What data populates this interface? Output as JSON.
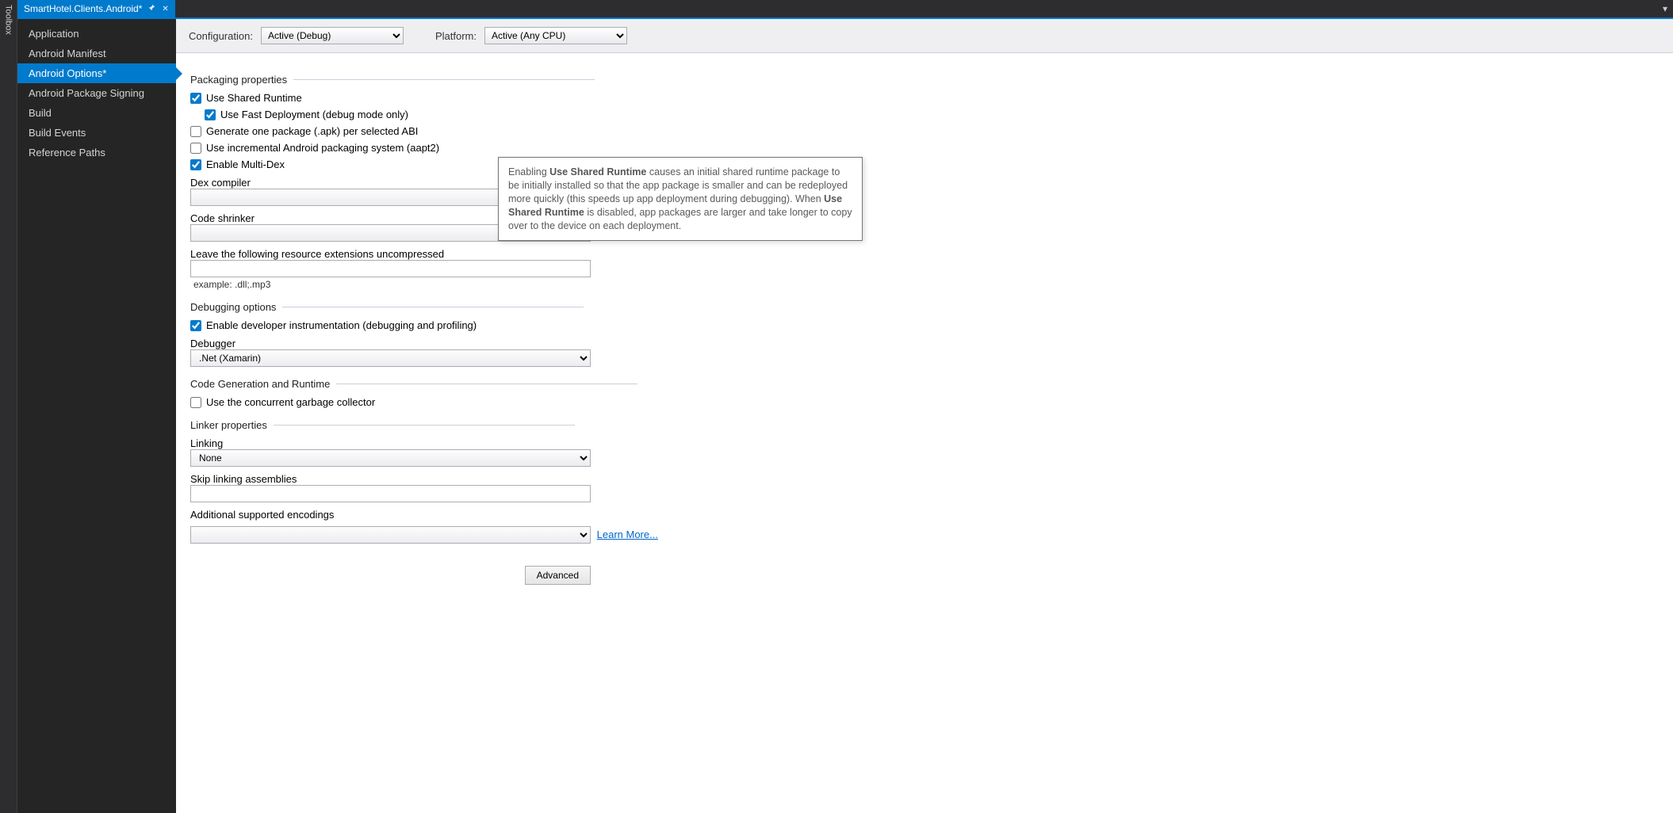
{
  "toolbox": {
    "label": "Toolbox"
  },
  "tab": {
    "title": "SmartHotel.Clients.Android*"
  },
  "overflow_glyph": "▾",
  "nav": {
    "items": [
      {
        "label": "Application",
        "selected": false
      },
      {
        "label": "Android Manifest",
        "selected": false
      },
      {
        "label": "Android Options*",
        "selected": true
      },
      {
        "label": "Android Package Signing",
        "selected": false
      },
      {
        "label": "Build",
        "selected": false
      },
      {
        "label": "Build Events",
        "selected": false
      },
      {
        "label": "Reference Paths",
        "selected": false
      }
    ]
  },
  "configbar": {
    "config_label": "Configuration:",
    "config_value": "Active (Debug)",
    "platform_label": "Platform:",
    "platform_value": "Active (Any CPU)"
  },
  "sections": {
    "packaging": "Packaging properties",
    "debugging": "Debugging options",
    "codegen": "Code Generation and Runtime",
    "linker": "Linker properties"
  },
  "fields": {
    "use_shared_runtime": "Use Shared Runtime",
    "use_fast_deployment": "Use Fast Deployment (debug mode only)",
    "gen_one_pkg": "Generate one package (.apk) per selected ABI",
    "incremental_pkg": "Use incremental Android packaging system (aapt2)",
    "multi_dex": "Enable Multi-Dex",
    "dex_compiler": "Dex compiler",
    "code_shrinker": "Code shrinker",
    "uncompressed": "Leave the following resource extensions uncompressed",
    "uncompressed_hint": "example: .dll;.mp3",
    "dev_instrumentation": "Enable developer instrumentation (debugging and profiling)",
    "debugger": "Debugger",
    "debugger_value": ".Net (Xamarin)",
    "concurrent_gc": "Use the concurrent garbage collector",
    "linking": "Linking",
    "linking_value": "None",
    "skip_linking": "Skip linking assemblies",
    "extra_encodings": "Additional supported encodings",
    "learn_more": "Learn More...",
    "advanced": "Advanced"
  },
  "tooltip": {
    "t1": "Enabling ",
    "b1": "Use Shared Runtime",
    "t2": " causes an initial shared runtime package to be initially installed so that the app package is smaller and can be redeployed more quickly (this speeds up app deployment during debugging). When ",
    "b2": "Use Shared Runtime",
    "t3": " is disabled, app packages are larger and take longer to copy over to the device on each deployment."
  }
}
